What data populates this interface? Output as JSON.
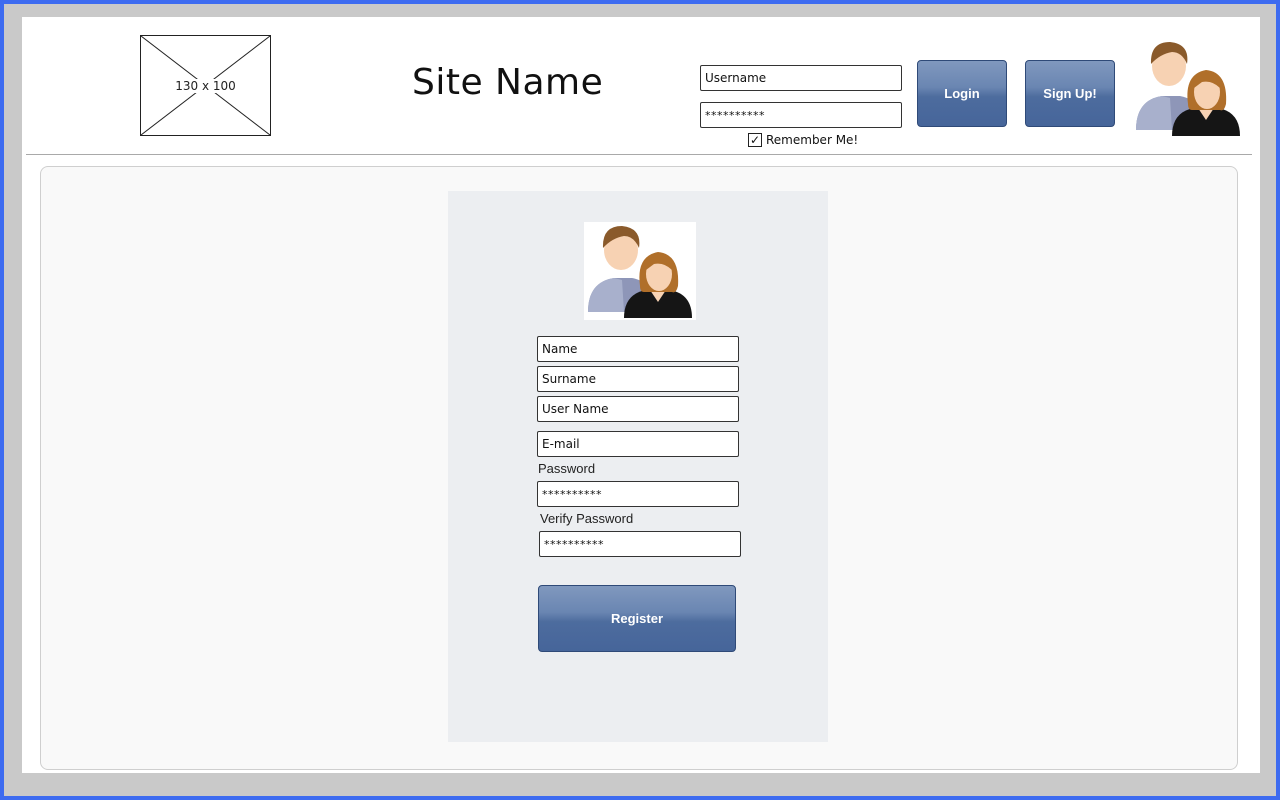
{
  "header": {
    "logo_placeholder_text": "130 x 100",
    "site_name": "Site Name",
    "login_form": {
      "username_value": "Username",
      "password_value": "**********",
      "remember_label": "Remember Me!",
      "remember_checked": true,
      "login_label": "Login",
      "signup_label": "Sign Up!"
    },
    "users_icon": "users-icon"
  },
  "registration": {
    "avatar_icon": "users-icon",
    "fields": {
      "name_value": "Name",
      "surname_value": "Surname",
      "username_value": "User Name",
      "email_value": "E-mail",
      "password_label": "Password",
      "password_value": "**********",
      "verify_label": "Verify Password",
      "verify_value": "**********"
    },
    "register_label": "Register"
  },
  "colors": {
    "frame_border": "#3d6bf0",
    "button_blue": "#4d6c9e",
    "card_bg": "#eceef1"
  }
}
